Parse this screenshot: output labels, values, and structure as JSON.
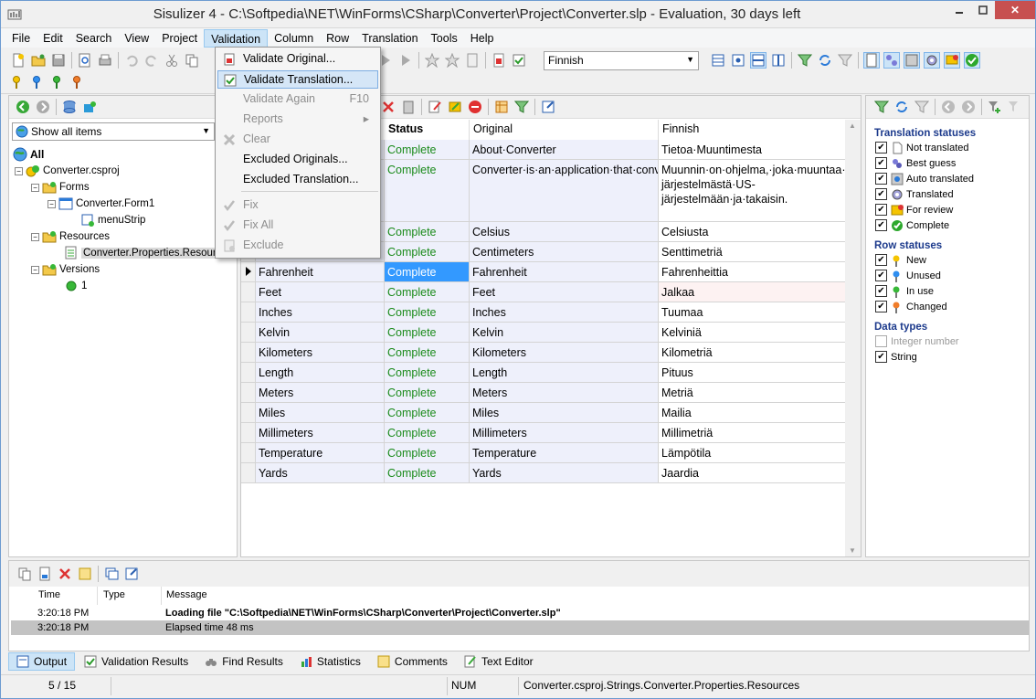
{
  "window": {
    "title": "Sisulizer 4 - C:\\Softpedia\\NET\\WinForms\\CSharp\\Converter\\Project\\Converter.slp - Evaluation, 30 days left",
    "close": "✕"
  },
  "menu": [
    "File",
    "Edit",
    "Search",
    "View",
    "Project",
    "Validation",
    "Column",
    "Row",
    "Translation",
    "Tools",
    "Help"
  ],
  "toolbar": {
    "language": "Finnish"
  },
  "validation_menu": {
    "items": [
      {
        "label": "Validate Original...",
        "shortcut": "",
        "enabled": true
      },
      {
        "label": "Validate Translation...",
        "shortcut": "",
        "enabled": true,
        "highlighted": true
      },
      {
        "label": "Validate Again",
        "shortcut": "F10",
        "enabled": false
      },
      {
        "label": "Reports",
        "shortcut": "▸",
        "enabled": false
      },
      {
        "label": "Clear",
        "shortcut": "",
        "enabled": false
      },
      {
        "label": "Excluded Originals...",
        "shortcut": "",
        "enabled": true
      },
      {
        "label": "Excluded Translation...",
        "shortcut": "",
        "enabled": true
      },
      {
        "label": "Fix",
        "shortcut": "",
        "enabled": false
      },
      {
        "label": "Fix All",
        "shortcut": "",
        "enabled": false
      },
      {
        "label": "Exclude",
        "shortcut": "",
        "enabled": false
      }
    ]
  },
  "left_panel": {
    "filter": "Show all items",
    "tree": [
      {
        "label": "All",
        "bold": true
      },
      {
        "label": "Converter.csproj"
      },
      {
        "label": "Forms"
      },
      {
        "label": "Converter.Form1"
      },
      {
        "label": "menuStrip"
      },
      {
        "label": "Resources"
      },
      {
        "label": "Converter.Properties.Resources",
        "selected": true
      },
      {
        "label": "Versions"
      },
      {
        "label": "1"
      }
    ]
  },
  "grid": {
    "columns": [
      "Status",
      "Original",
      "Finnish"
    ],
    "rows": [
      {
        "id": "",
        "status": "Complete",
        "original": "About·Converter",
        "translation": "Tietoa·Muuntimesta"
      },
      {
        "id": "",
        "status": "Complete",
        "original": "Converter·is·an·application·that·converts·metric·units·to·US·units·and·back.",
        "translation": "Muunnin·on·ohjelma,·joka·muuntaa·mittayksiköitä·SI-järjestelmästä·US-järjestelmään·ja·takaisin."
      },
      {
        "id": "",
        "status": "Complete",
        "original": "Celsius",
        "translation": "Celsiusta"
      },
      {
        "id": "",
        "status": "Complete",
        "original": "Centimeters",
        "translation": "Senttimetriä"
      },
      {
        "id": "Fahrenheit",
        "status": "Complete",
        "original": "Fahrenheit",
        "translation": "Fahrenheittia",
        "current": true
      },
      {
        "id": "Feet",
        "status": "Complete",
        "original": "Feet",
        "translation": "Jalkaa"
      },
      {
        "id": "Inches",
        "status": "Complete",
        "original": "Inches",
        "translation": "Tuumaa"
      },
      {
        "id": "Kelvin",
        "status": "Complete",
        "original": "Kelvin",
        "translation": "Kelviniä"
      },
      {
        "id": "Kilometers",
        "status": "Complete",
        "original": "Kilometers",
        "translation": "Kilometriä"
      },
      {
        "id": "Length",
        "status": "Complete",
        "original": "Length",
        "translation": "Pituus"
      },
      {
        "id": "Meters",
        "status": "Complete",
        "original": "Meters",
        "translation": "Metriä"
      },
      {
        "id": "Miles",
        "status": "Complete",
        "original": "Miles",
        "translation": "Mailia"
      },
      {
        "id": "Millimeters",
        "status": "Complete",
        "original": "Millimeters",
        "translation": "Millimetriä"
      },
      {
        "id": "Temperature",
        "status": "Complete",
        "original": "Temperature",
        "translation": "Lämpötila"
      },
      {
        "id": "Yards",
        "status": "Complete",
        "original": "Yards",
        "translation": "Jaardia"
      }
    ]
  },
  "right_panel": {
    "translation_statuses_title": "Translation statuses",
    "translation_statuses": [
      "Not translated",
      "Best guess",
      "Auto translated",
      "Translated",
      "For review",
      "Complete"
    ],
    "row_statuses_title": "Row statuses",
    "row_statuses": [
      "New",
      "Unused",
      "In use",
      "Changed"
    ],
    "data_types_title": "Data types",
    "data_types": [
      {
        "label": "Integer number",
        "checked": false,
        "enabled": false
      },
      {
        "label": "String",
        "checked": true,
        "enabled": true
      }
    ]
  },
  "output": {
    "headers": [
      "Time",
      "Type",
      "Message"
    ],
    "rows": [
      {
        "time": "3:20:18 PM",
        "type": "",
        "message": "Loading file \"C:\\Softpedia\\NET\\WinForms\\CSharp\\Converter\\Project\\Converter.slp\"",
        "bold": true
      },
      {
        "time": "3:20:18 PM",
        "type": "",
        "message": "Elapsed time 48 ms",
        "selected": true
      }
    ]
  },
  "bottom_tabs": [
    "Output",
    "Validation Results",
    "Find Results",
    "Statistics",
    "Comments",
    "Text Editor"
  ],
  "statusbar": {
    "position": "5 / 15",
    "num": "NUM",
    "path": "Converter.csproj.Strings.Converter.Properties.Resources"
  }
}
